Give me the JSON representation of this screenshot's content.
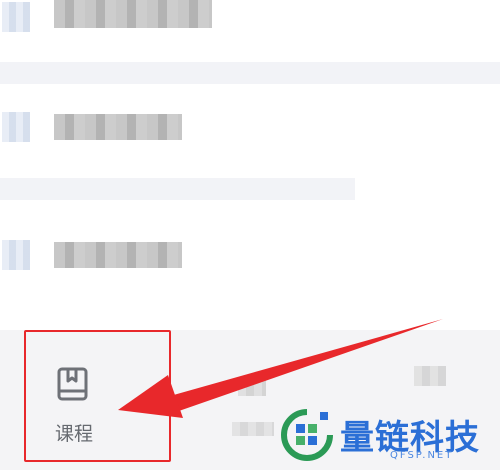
{
  "list_rows": [
    {
      "blurred": true
    },
    {
      "blurred": true
    },
    {
      "blurred": true
    }
  ],
  "tabbar": {
    "tabs": [
      {
        "label": "课程",
        "icon": "book-icon",
        "highlighted": true
      },
      {
        "label": "",
        "blurred": true
      },
      {
        "label": "",
        "blurred": true
      }
    ]
  },
  "annotation": {
    "color": "#e8282b",
    "arrow_target": "tab-courses"
  },
  "watermark": {
    "brand": "量链科技",
    "domain": "QFSP.NET",
    "color": "#2b6fd6"
  }
}
